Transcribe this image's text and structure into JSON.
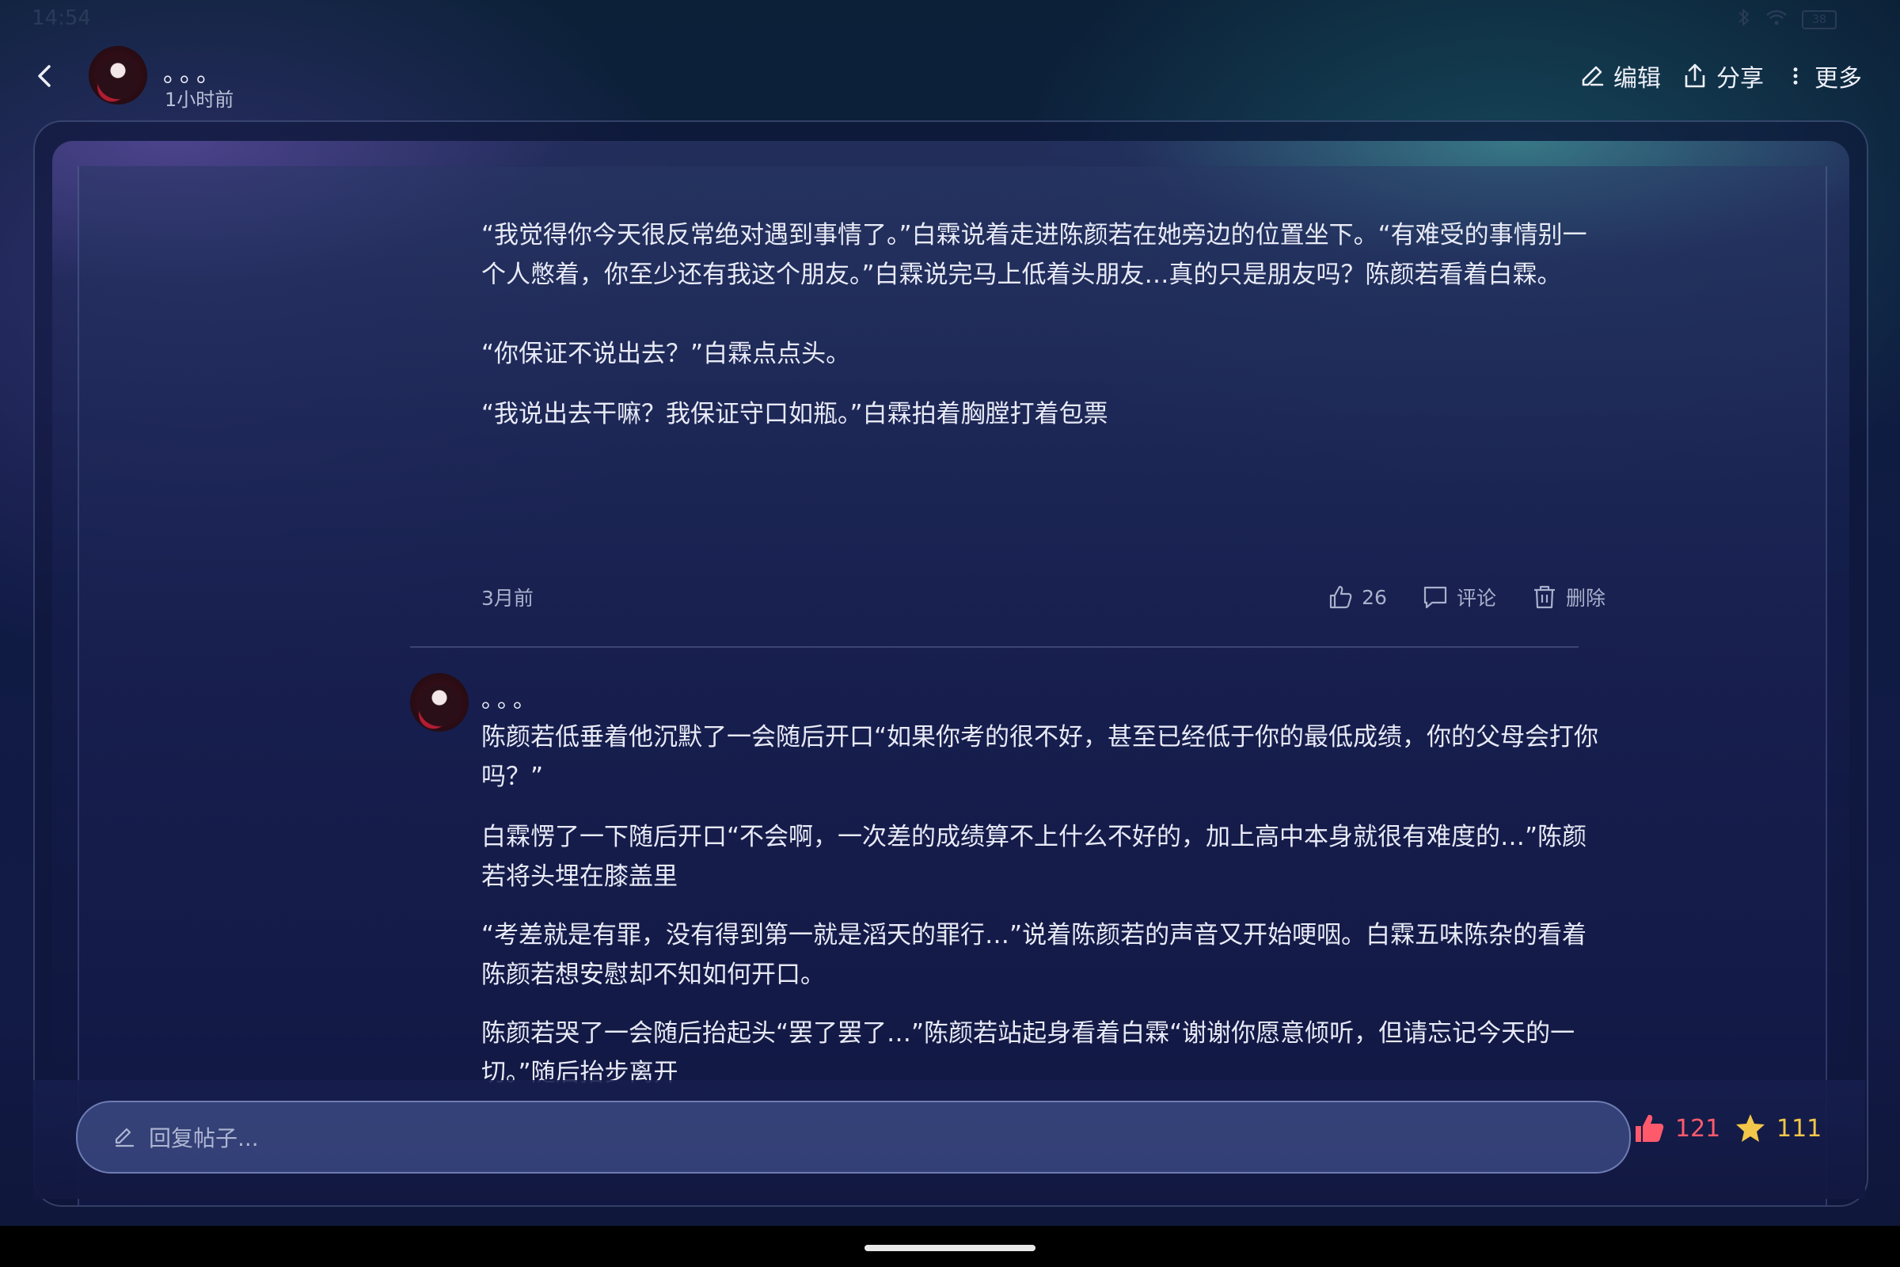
{
  "status_bar": {
    "time": "14:54",
    "battery": "38"
  },
  "header": {
    "author_name": "。。。",
    "post_time": "1小时前",
    "actions": {
      "edit": "编辑",
      "share": "分享",
      "more": "更多"
    }
  },
  "post": {
    "paragraphs": [
      "“我觉得你今天很反常绝对遇到事情了。”白霖说着走进陈颜若在她旁边的位置坐下。“有难受的事情别一个人憋着，你至少还有我这个朋友。”白霖说完马上低着头朋友…真的只是朋友吗？陈颜若看着白霖。",
      "“你保证不说出去？”白霖点点头。",
      "“我说出去干嘛？我保证守口如瓶。”白霖拍着胸膛打着包票"
    ],
    "date": "3月前",
    "likes": "26",
    "comment_label": "评论",
    "delete_label": "删除"
  },
  "reply": {
    "author_name": "。。。",
    "paragraphs": [
      "陈颜若低垂着他沉默了一会随后开口“如果你考的很不好，甚至已经低于你的最低成绩，你的父母会打你吗？”",
      "白霖愣了一下随后开口“不会啊，一次差的成绩算不上什么不好的，加上高中本身就很有难度的…”陈颜若将头埋在膝盖里",
      "“考差就是有罪，没有得到第一就是滔天的罪行…”说着陈颜若的声音又开始哽咽。白霖五味陈杂的看着陈颜若想安慰却不知如何开口。",
      "陈颜若哭了一会随后抬起头“罢了罢了…”陈颜若站起身看着白霖“谢谢你愿意倾听，但请忘记今天的一切。”随后抬步离开"
    ]
  },
  "reply_bar": {
    "placeholder": "回复帖子...",
    "like_count": "121",
    "star_count": "111"
  },
  "colors": {
    "like": "#ff5a6c",
    "star": "#f2c74a",
    "text": "#e8eaf6",
    "muted": "#a9b1cc"
  }
}
